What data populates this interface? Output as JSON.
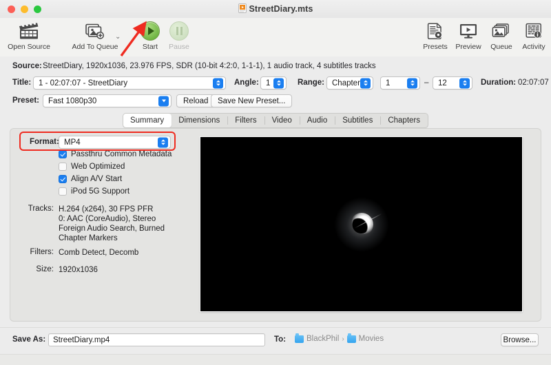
{
  "window": {
    "title": "StreetDiary.mts",
    "doc_icon": "video-file-icon",
    "traffic_lights": [
      "close-button",
      "minimize-button",
      "zoom-button"
    ]
  },
  "toolbar": {
    "left_items": [
      {
        "name": "open-source",
        "label": "Open Source",
        "icon": "clapperboard-icon",
        "enabled": true
      },
      {
        "name": "add-to-queue",
        "label": "Add To Queue",
        "icon": "add-image-stack-icon",
        "enabled": true
      },
      {
        "name": "start",
        "label": "Start",
        "icon": "play-icon",
        "enabled": true
      },
      {
        "name": "pause",
        "label": "Pause",
        "icon": "pause-icon",
        "enabled": false
      }
    ],
    "add_to_queue_chevron": "chevron-down-icon",
    "right_items": [
      {
        "name": "presets",
        "label": "Presets",
        "icon": "presets-document-gear-icon"
      },
      {
        "name": "preview",
        "label": "Preview",
        "icon": "monitor-play-icon"
      },
      {
        "name": "queue",
        "label": "Queue",
        "icon": "image-stack-icon"
      },
      {
        "name": "activity",
        "label": "Activity",
        "icon": "activity-log-info-icon"
      }
    ]
  },
  "source": {
    "label": "Source:",
    "value": "StreetDiary, 1920x1036, 23.976 FPS, SDR (10-bit 4:2:0, 1-1-1), 1 audio track, 4 subtitles tracks"
  },
  "title_row": {
    "title_label": "Title:",
    "title_value": "1 - 02:07:07 - StreetDiary",
    "angle_label": "Angle:",
    "angle_value": "1",
    "range_label": "Range:",
    "range_value": "Chapters",
    "chapter_start": "1",
    "range_dash": "–",
    "chapter_end": "12",
    "duration_label": "Duration:",
    "duration_value": "02:07:07"
  },
  "preset_row": {
    "preset_label": "Preset:",
    "preset_value": "Fast 1080p30",
    "reload_label": "Reload",
    "save_new_preset_label": "Save New Preset..."
  },
  "tabs": [
    {
      "label": "Summary",
      "active": true
    },
    {
      "label": "Dimensions",
      "active": false
    },
    {
      "label": "Filters",
      "active": false
    },
    {
      "label": "Video",
      "active": false
    },
    {
      "label": "Audio",
      "active": false
    },
    {
      "label": "Subtitles",
      "active": false
    },
    {
      "label": "Chapters",
      "active": false
    }
  ],
  "summary": {
    "format_label": "Format:",
    "format_value": "MP4",
    "highlight_color": "#ef2b20",
    "checkboxes": [
      {
        "label": "Passthru Common Metadata",
        "checked": true
      },
      {
        "label": "Web Optimized",
        "checked": false
      },
      {
        "label": "Align A/V Start",
        "checked": true
      },
      {
        "label": "iPod 5G Support",
        "checked": false
      }
    ],
    "tracks_label": "Tracks:",
    "tracks_value": "H.264 (x264), 30 FPS PFR\n0: AAC (CoreAudio), Stereo\nForeign Audio Search, Burned\nChapter Markers",
    "filters_label": "Filters:",
    "filters_value": "Comb Detect, Decomb",
    "size_label": "Size:",
    "size_value": "1920x1036",
    "preview_image": "dark-frame-with-bright-crescent-flare"
  },
  "bottom": {
    "save_as_label": "Save As:",
    "save_as_value": "StreetDiary.mp4",
    "to_label": "To:",
    "path_parts": [
      "BlackPhil",
      "Movies"
    ],
    "path_separator": "›",
    "browse_label": "Browse..."
  },
  "annotations": {
    "arrow_color": "#ef2b20",
    "arrow_target": "start-button"
  }
}
